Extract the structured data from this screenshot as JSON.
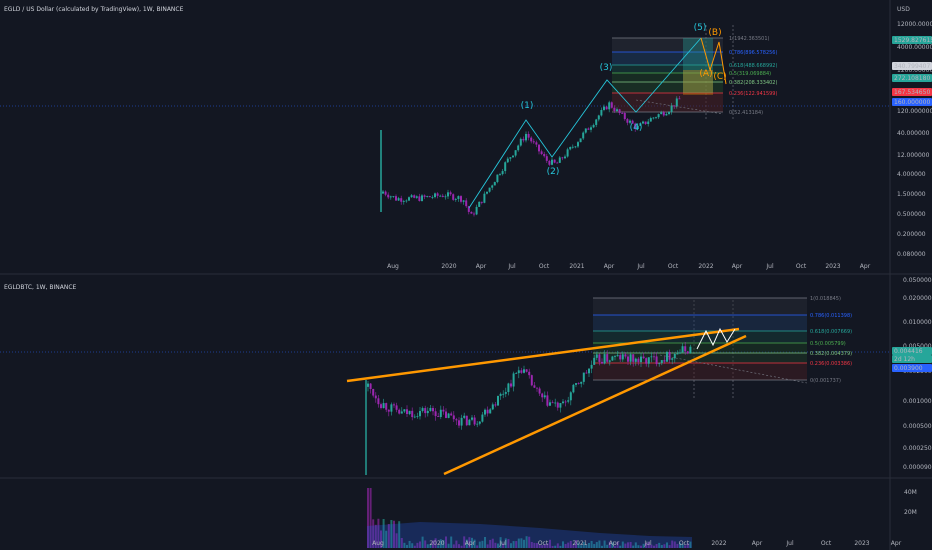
{
  "top": {
    "title": "EGLD / US Dollar (calculated by TradingView), 1W, BINANCE",
    "currency": "USD",
    "price_ticks": [
      "12000.000000",
      "4000.000000",
      "1200.000000",
      "400.000000",
      "120.000000",
      "40.000000",
      "12.000000",
      "4.000000",
      "1.500000",
      "0.500000",
      "0.200000",
      "0.080000"
    ],
    "x_ticks": [
      "Aug",
      "2020",
      "Apr",
      "Jul",
      "Oct",
      "2021",
      "Apr",
      "Jul",
      "Oct",
      "2022",
      "Apr",
      "Jul",
      "Oct",
      "2023",
      "Apr"
    ],
    "fib_labels": [
      "1(1942.363501)",
      "0.786(896.578256)",
      "0.618(488.668992)",
      "0.5(319.069884)",
      "0.382(208.333402)",
      "0.236(122.941599)",
      "0(52.413184)"
    ],
    "price_badges": [
      {
        "text": "1529.827615",
        "color": "#26a69a"
      },
      {
        "text": "340.799407",
        "color": "#d1d4dc"
      },
      {
        "text": "272.108180",
        "color": "#26a69a"
      },
      {
        "text": "167.534650",
        "color": "#f23645"
      },
      {
        "text": "160.000000",
        "color": "#2962ff"
      }
    ],
    "waves": [
      "(1)",
      "(2)",
      "(3)",
      "(4)",
      "(5)",
      "(A)",
      "(B)",
      "(C)"
    ]
  },
  "bottom": {
    "title": "EGLDBTC, 1W, BINANCE",
    "price_ticks": [
      "0.050000",
      "0.020000",
      "0.010000",
      "0.005000",
      "0.002500",
      "0.001000",
      "0.000500",
      "0.000250",
      "0.000090"
    ],
    "x_ticks": [
      "Aug",
      "2020",
      "Apr",
      "Jul",
      "Oct",
      "2021",
      "Apr",
      "Jul",
      "Oct",
      "2022",
      "Apr",
      "Jul",
      "Oct",
      "2023",
      "Apr"
    ],
    "fib_labels": [
      "1(0.018845)",
      "0.786(0.011398)",
      "0.618(0.007669)",
      "0.5(0.005799)",
      "0.382(0.004379)",
      "0.236(0.003386)",
      "0(0.001737)"
    ],
    "price_badges": [
      {
        "text": "0.004416",
        "color": "#26a69a"
      },
      {
        "text": "2d 12h",
        "color": "#26a69a"
      },
      {
        "text": "0.003900",
        "color": "#2962ff"
      }
    ]
  },
  "volume": {
    "ticks": [
      "40M",
      "20M"
    ]
  },
  "chart_data": [
    {
      "type": "line",
      "title": "EGLD / US Dollar (calculated by TradingView), 1W, BINANCE",
      "y_scale": "log",
      "y_unit": "USD",
      "series": [
        {
          "x": [
            "Jul 2020",
            "Aug 2020",
            "Nov 2019",
            "Feb 2020",
            "Mar 2020",
            "Jul 2020",
            "Sep 2020",
            "Nov 2020",
            "Jan 2021",
            "Mar 2021",
            "Apr 2021",
            "Jun 2021",
            "Aug 2021",
            "Sep 2021"
          ],
          "values": [
            40,
            3,
            1.2,
            1.5,
            0.5,
            40,
            7,
            15,
            60,
            200,
            210,
            55,
            150,
            240
          ]
        }
      ],
      "fib_levels": [
        1942.363501,
        896.578256,
        488.668992,
        319.069884,
        208.333402,
        122.941599,
        52.413184
      ]
    },
    {
      "type": "line",
      "title": "EGLDBTC, 1W, BINANCE",
      "y_scale": "log",
      "series": [
        {
          "x": [
            "Jul 2020",
            "Aug 2020",
            "Nov 2019",
            "Feb 2020",
            "May 2020",
            "Jul 2020",
            "Sep 2020",
            "Nov 2020",
            "Jan 2021",
            "Mar 2021",
            "May 2021",
            "Jul 2021",
            "Sep 2021"
          ],
          "values": [
            0.0028,
            0.0007,
            0.0005,
            0.0005,
            0.0004,
            0.0018,
            0.0007,
            0.0009,
            0.0016,
            0.003,
            0.003,
            0.0028,
            0.0044
          ]
        }
      ],
      "fib_levels": [
        0.018845,
        0.011398,
        0.007669,
        0.005799,
        0.004379,
        0.003386,
        0.001737
      ]
    }
  ]
}
